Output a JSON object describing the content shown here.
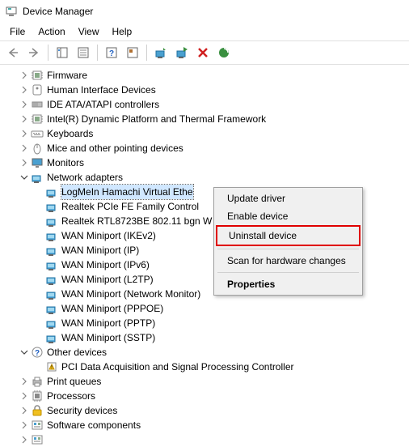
{
  "window": {
    "title": "Device Manager"
  },
  "menu": {
    "file": "File",
    "action": "Action",
    "view": "View",
    "help": "Help"
  },
  "tree": {
    "items": [
      {
        "label": "Firmware",
        "exp": "right",
        "icon": "chip"
      },
      {
        "label": "Human Interface Devices",
        "exp": "right",
        "icon": "hid"
      },
      {
        "label": "IDE ATA/ATAPI controllers",
        "exp": "right",
        "icon": "ide"
      },
      {
        "label": "Intel(R) Dynamic Platform and Thermal Framework",
        "exp": "right",
        "icon": "chip"
      },
      {
        "label": "Keyboards",
        "exp": "right",
        "icon": "keyboard"
      },
      {
        "label": "Mice and other pointing devices",
        "exp": "right",
        "icon": "mouse"
      },
      {
        "label": "Monitors",
        "exp": "right",
        "icon": "monitor"
      },
      {
        "label": "Network adapters",
        "exp": "down",
        "icon": "network",
        "children": [
          {
            "label": "LogMeIn Hamachi Virtual Ethe",
            "icon": "network",
            "selected": true
          },
          {
            "label": "Realtek PCIe FE Family Control",
            "icon": "network"
          },
          {
            "label": "Realtek RTL8723BE 802.11 bgn W",
            "icon": "network"
          },
          {
            "label": "WAN Miniport (IKEv2)",
            "icon": "network"
          },
          {
            "label": "WAN Miniport (IP)",
            "icon": "network"
          },
          {
            "label": "WAN Miniport (IPv6)",
            "icon": "network"
          },
          {
            "label": "WAN Miniport (L2TP)",
            "icon": "network"
          },
          {
            "label": "WAN Miniport (Network Monitor)",
            "icon": "network"
          },
          {
            "label": "WAN Miniport (PPPOE)",
            "icon": "network"
          },
          {
            "label": "WAN Miniport (PPTP)",
            "icon": "network"
          },
          {
            "label": "WAN Miniport (SSTP)",
            "icon": "network"
          }
        ]
      },
      {
        "label": "Other devices",
        "exp": "down",
        "icon": "other",
        "children": [
          {
            "label": "PCI Data Acquisition and Signal Processing Controller",
            "icon": "warn"
          }
        ]
      },
      {
        "label": "Print queues",
        "exp": "right",
        "icon": "printer"
      },
      {
        "label": "Processors",
        "exp": "right",
        "icon": "cpu"
      },
      {
        "label": "Security devices",
        "exp": "right",
        "icon": "security"
      },
      {
        "label": "Software components",
        "exp": "right",
        "icon": "software"
      },
      {
        "label": " ",
        "exp": "right",
        "icon": "software"
      }
    ]
  },
  "contextmenu": {
    "update": "Update driver",
    "enable": "Enable device",
    "uninstall": "Uninstall device",
    "scan": "Scan for hardware changes",
    "properties": "Properties"
  }
}
